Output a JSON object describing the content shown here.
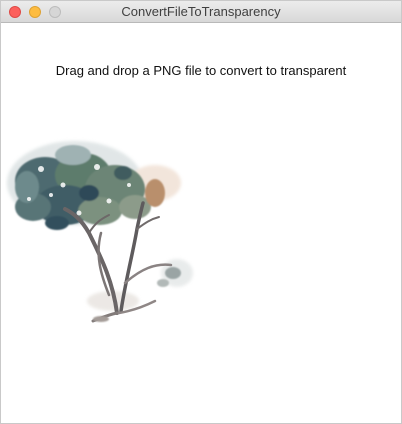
{
  "window": {
    "title": "ConvertFileToTransparency"
  },
  "content": {
    "instruction": "Drag and drop a PNG file to convert to transparent"
  },
  "colors": {
    "close": "#fc605c",
    "minimize": "#fdbc40",
    "zoom": "#d6d6d6",
    "foliage": "#5a7470",
    "trunk": "#6f6a6a"
  },
  "icons": {
    "preview": "watercolor-tree-image"
  }
}
